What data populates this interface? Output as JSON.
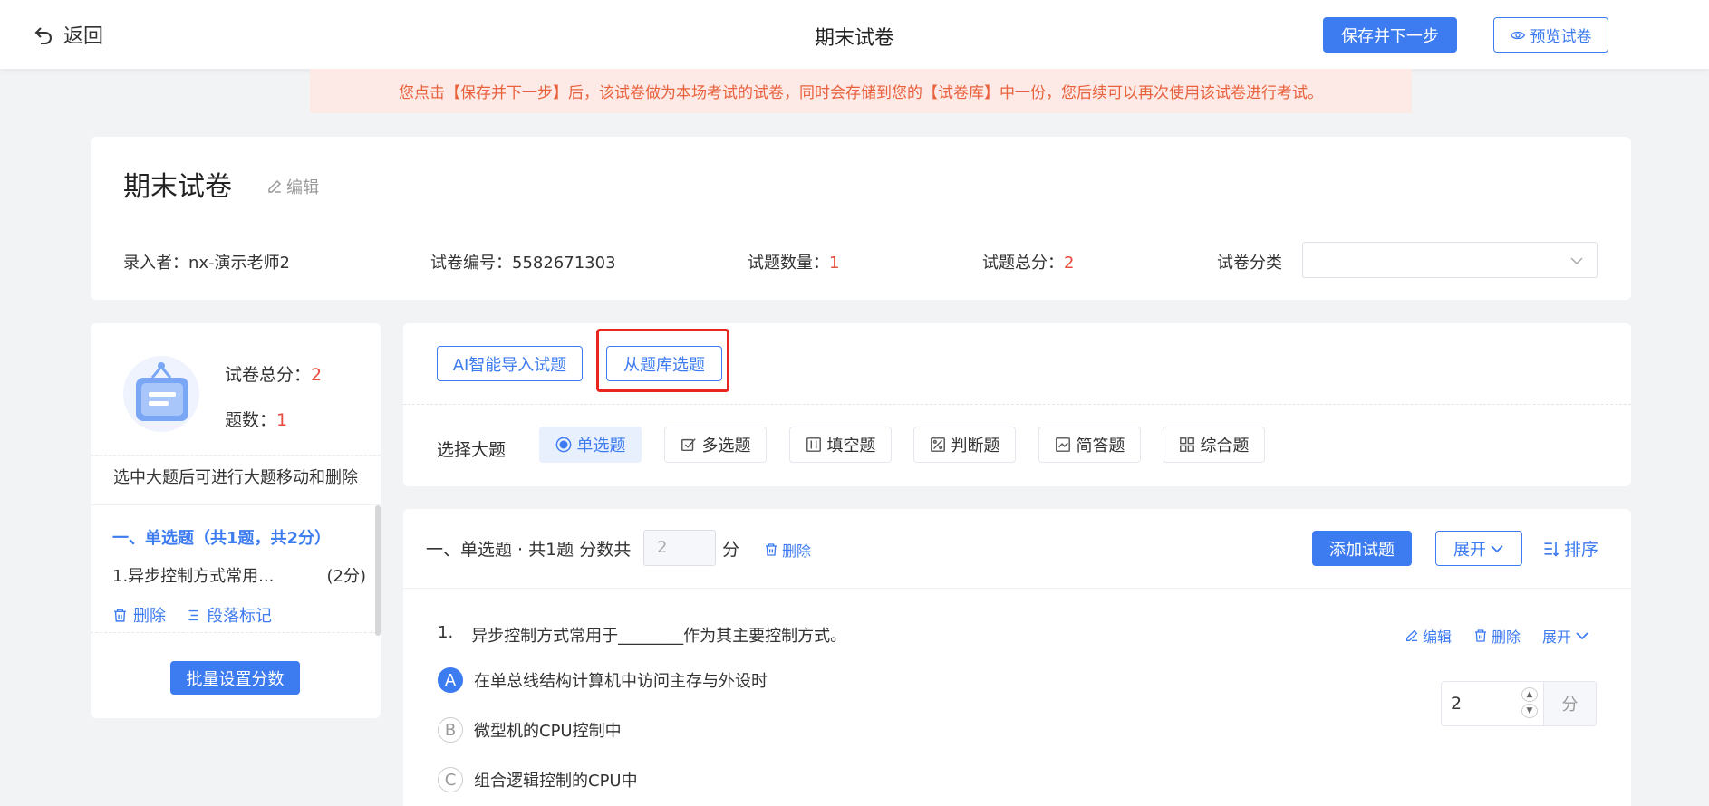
{
  "topbar": {
    "back_label": "返回",
    "page_title": "期末试卷",
    "save_next_label": "保存并下一步",
    "preview_label": "预览试卷"
  },
  "notice": "您点击【保存并下一步】后，该试卷做为本场考试的试卷，同时会存储到您的【试卷库】中一份，您后续可以再次使用该试卷进行考试。",
  "paper": {
    "title": "期末试卷",
    "edit_label": "编辑",
    "creator_label": "录入者：",
    "creator": "nx-演示老师2",
    "code_label": "试卷编号：",
    "code": "5582671303",
    "count_label": "试题数量：",
    "count": "1",
    "total_label": "试题总分：",
    "total": "2",
    "category_label": "试卷分类",
    "category_value": ""
  },
  "left_panel": {
    "total_label": "试卷总分：",
    "total": "2",
    "count_label": "题数：",
    "count": "1",
    "hint": "选中大题后可进行大题移动和删除",
    "section_title": "一、单选题（共1题，共2分）",
    "question_text": "1.异步控制方式常用...",
    "question_score": "(2分)",
    "delete_label": "删除",
    "paragraph_mark_label": "段落标记",
    "batch_label": "批量设置分数"
  },
  "import": {
    "ai_label": "AI智能导入试题",
    "bank_label": "从题库选题"
  },
  "question_types": {
    "label": "选择大题",
    "types": [
      {
        "label": "单选题",
        "icon": "radio-icon"
      },
      {
        "label": "多选题",
        "icon": "checkbox-icon"
      },
      {
        "label": "填空题",
        "icon": "fill-blank-icon"
      },
      {
        "label": "判断题",
        "icon": "judge-icon"
      },
      {
        "label": "简答题",
        "icon": "short-answer-icon"
      },
      {
        "label": "综合题",
        "icon": "grid-icon"
      }
    ],
    "active_index": 0
  },
  "section": {
    "title": "一、单选题 · 共1题 分数共",
    "score_placeholder": "2",
    "unit": "分",
    "delete_label": "删除",
    "add_label": "添加试题",
    "expand_label": "展开",
    "sort_label": "排序"
  },
  "question": {
    "number": "1.",
    "text": "异步控制方式常用于________作为其主要控制方式。",
    "edit_label": "编辑",
    "delete_label": "删除",
    "expand_label": "展开",
    "options": [
      {
        "letter": "A",
        "text": "在单总线结构计算机中访问主存与外设时",
        "correct": true
      },
      {
        "letter": "B",
        "text": "微型机的CPU控制中",
        "correct": false
      },
      {
        "letter": "C",
        "text": "组合逻辑控制的CPU中",
        "correct": false
      }
    ],
    "score": "2",
    "score_unit": "分"
  },
  "colors": {
    "primary": "#3d7bf0",
    "danger": "#e84a3d",
    "notice_bg": "#fde9e6",
    "notice_text": "#e8623d",
    "highlight": "#e8261f"
  }
}
